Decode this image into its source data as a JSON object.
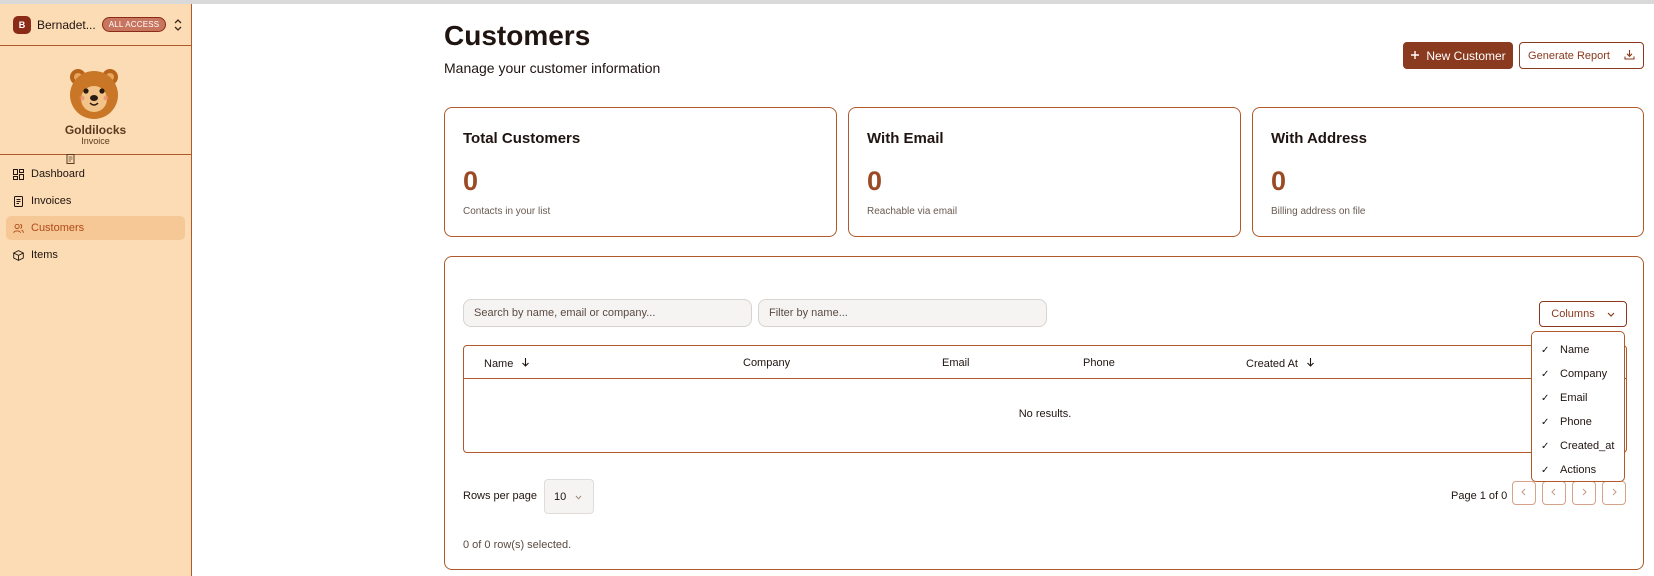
{
  "account": {
    "initial": "B",
    "name": "Bernadet...",
    "badge": "ALL ACCESS"
  },
  "brand": {
    "title": "Goldilocks",
    "subtitle": "Invoice"
  },
  "nav": [
    {
      "label": "Dashboard",
      "icon": "dashboard-icon",
      "active": false
    },
    {
      "label": "Invoices",
      "icon": "invoice-icon",
      "active": false
    },
    {
      "label": "Customers",
      "icon": "users-icon",
      "active": true
    },
    {
      "label": "Items",
      "icon": "box-icon",
      "active": false
    }
  ],
  "header": {
    "title": "Customers",
    "subtitle": "Manage your customer information",
    "new_button": "New Customer",
    "report_button": "Generate Report"
  },
  "stats": [
    {
      "title": "Total Customers",
      "value": "0",
      "desc": "Contacts in your list"
    },
    {
      "title": "With Email",
      "value": "0",
      "desc": "Reachable via email"
    },
    {
      "title": "With Address",
      "value": "0",
      "desc": "Billing address on file"
    }
  ],
  "table": {
    "search_placeholder": "Search by name, email or company...",
    "filter_placeholder": "Filter by name...",
    "columns_button": "Columns",
    "headers": [
      "Name",
      "Company",
      "Email",
      "Phone",
      "Created At"
    ],
    "empty_text": "No results.",
    "rows_per_page_label": "Rows per page",
    "rows_per_page_value": "10",
    "page_info": "Page 1 of 0",
    "selected_info": "0 of 0 row(s) selected."
  },
  "columns_menu": [
    "Name",
    "Company",
    "Email",
    "Phone",
    "Created_at",
    "Actions"
  ],
  "colors": {
    "accent": "#8a3a1e",
    "sidebar_bg": "#fcdcb4",
    "border": "#b05a2b",
    "stat_value": "#9a4a24"
  }
}
